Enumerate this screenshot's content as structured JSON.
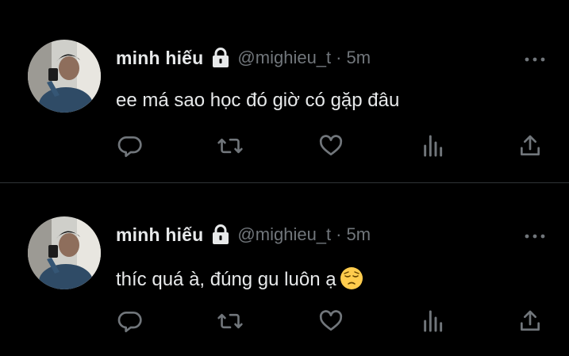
{
  "colors": {
    "background": "#000000",
    "text_primary": "#e7e9ea",
    "text_secondary": "#71767b",
    "divider": "#2f3336"
  },
  "tweets": [
    {
      "display_name": "minh hiếu",
      "handle": "@mighieu_t",
      "separator": "·",
      "time": "5m",
      "text": "ee má sao học đó giờ có gặp đâu",
      "emoji": "",
      "icons": [
        "lock-icon",
        "more-icon",
        "reply-icon",
        "retweet-icon",
        "like-icon",
        "views-icon",
        "share-icon"
      ]
    },
    {
      "display_name": "minh hiếu",
      "handle": "@mighieu_t",
      "separator": "·",
      "time": "5m",
      "text": "thíc quá à, đúng gu luôn ạ",
      "emoji": "pensive-face",
      "icons": [
        "lock-icon",
        "more-icon",
        "reply-icon",
        "retweet-icon",
        "like-icon",
        "views-icon",
        "share-icon"
      ]
    }
  ]
}
